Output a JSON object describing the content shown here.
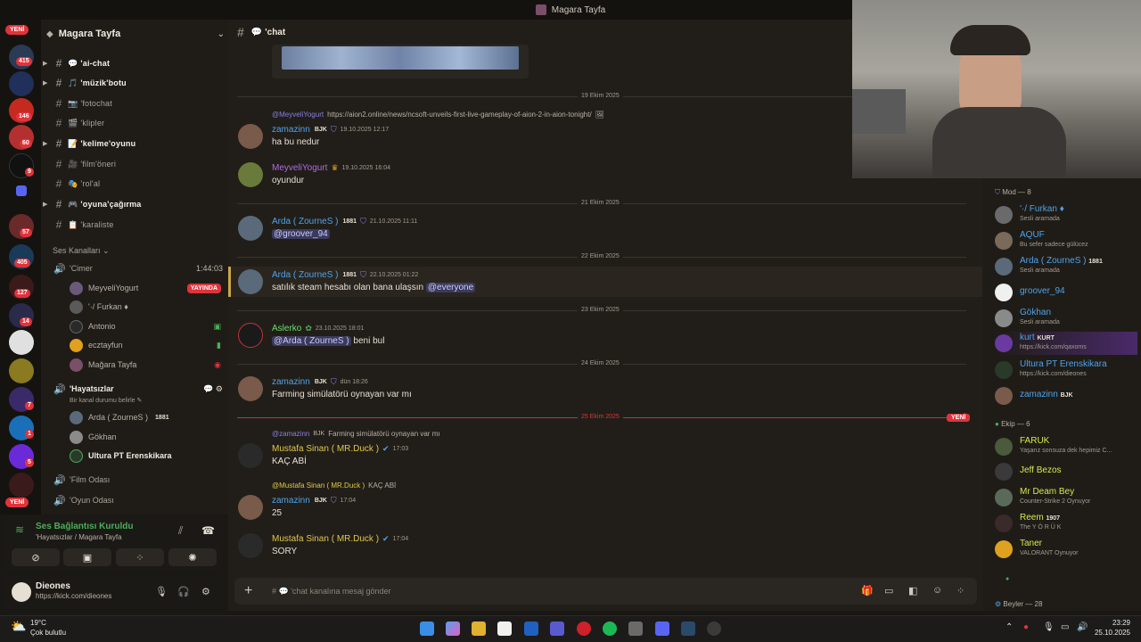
{
  "window": {
    "title": "Magara Tayfa"
  },
  "rail": {
    "yeni_top": "YENİ",
    "yeni_bottom": "YENİ",
    "badges": [
      "415",
      "146",
      "60",
      "9",
      "57",
      "405",
      "127",
      "14",
      "7",
      "1",
      "5"
    ]
  },
  "sidebar": {
    "guild_name": "Magara Tayfa",
    "channels": [
      {
        "emoji": "💬",
        "label": "'ai-chat",
        "unread": true
      },
      {
        "emoji": "🎵",
        "label": "'müzik'botu",
        "unread": true
      },
      {
        "emoji": "📷",
        "label": "'fotochat",
        "unread": false
      },
      {
        "emoji": "🎬",
        "label": "'klipler",
        "unread": false
      },
      {
        "emoji": "📝",
        "label": "'kelime'oyunu",
        "unread": true
      },
      {
        "emoji": "🎥",
        "label": "'film'öneri",
        "unread": false
      },
      {
        "emoji": "🎭",
        "label": "'rol'al",
        "unread": false
      },
      {
        "emoji": "🎮",
        "label": "'oyuna'çağırma",
        "unread": true
      },
      {
        "emoji": "📋",
        "label": "'karaliste",
        "unread": false
      }
    ],
    "voice_category": "Ses Kanalları",
    "voice_channels": {
      "cimer": {
        "label": "'Cimer",
        "time": "1:44:03"
      },
      "hayatsizlar": {
        "label": "'Hayatsızlar",
        "status": "Bir kanal durumu belirle"
      },
      "film": {
        "label": "'Film Odası"
      },
      "oyun": {
        "label": "'Oyun Odası"
      }
    },
    "cimer_users": [
      "MeyveliYogurt",
      "'·/ Furkan ♦",
      "Antonio",
      "ecztayfun",
      "Mağara Tayfa"
    ],
    "live_label": "YAYINDA",
    "hayat_users": [
      "Arda ( ZourneS )",
      "Gökhan",
      "Ultura PT Erenskikara"
    ],
    "hayat_tag": "1881"
  },
  "voice": {
    "connected": "Ses Bağlantısı Kuruldu",
    "location": "'Hayatsızlar / Magara Tayfa"
  },
  "user": {
    "name": "Dieones",
    "status": "https://kick.com/dieones"
  },
  "chat": {
    "channel_name": "'chat",
    "dates": [
      "19 Ekim 2025",
      "21 Ekim 2025",
      "22 Ekim 2025",
      "23 Ekim 2025",
      "24 Ekim 2025",
      "25 Ekim 2025"
    ],
    "yeni": "YENİ",
    "reply1": {
      "author": "@MeyveliYogurt",
      "text": "https://aion2.online/news/ncsoft-unveils-first-live-gameplay-of-aion-2-in-aion-tonight/"
    },
    "m1": {
      "author": "zamazinn",
      "tag": "BJK",
      "time": "19.10.2025 12:17",
      "text": "ha bu nedur"
    },
    "m2": {
      "author": "MeyveliYogurt",
      "time": "19.10.2025 16:04",
      "text": "oyundur"
    },
    "m3": {
      "author": "Arda ( ZourneS )",
      "tag": "1881",
      "time": "21.10.2025 11:11",
      "text": "@groover_94"
    },
    "m4": {
      "author": "Arda ( ZourneS )",
      "tag": "1881",
      "time": "22.10.2025 01:22",
      "text": "satılık steam hesabı olan bana ulaşsın",
      "mention": "@everyone"
    },
    "m5": {
      "author": "Aslerko",
      "time": "23.10.2025 18:01",
      "mention": "@Arda ( ZourneS )",
      "text": "beni bul"
    },
    "m6": {
      "author": "zamazinn",
      "tag": "BJK",
      "time": "dün 18:26",
      "text": "Farming simülatörü oynayan var mı"
    },
    "reply2": {
      "author": "@zamazinn",
      "tag": "BJK",
      "text": "Farming simülatörü oynayan var mı"
    },
    "m7": {
      "author": "Mustafa Sinan ( MR.Duck )",
      "time": "17:03",
      "text": "KAÇ ABİ"
    },
    "reply3": {
      "author": "@Mustafa Sinan ( MR.Duck )",
      "text": "KAÇ ABİ"
    },
    "m8": {
      "author": "zamazinn",
      "tag": "BJK",
      "time": "17:04",
      "text": "25"
    },
    "m9": {
      "author": "Mustafa Sinan ( MR.Duck )",
      "time": "17:04",
      "text": "SORY"
    },
    "input_placeholder": "'chat kanalına mesaj gönder"
  },
  "members": {
    "mod_header": "Mod — 8",
    "mods": [
      {
        "name": "'·/ Furkan ♦",
        "status": "Sesli aramada",
        "color": "#4fa3e8"
      },
      {
        "name": "AQUF",
        "status": "Bu sefer sadece gülücez",
        "color": "#4fa3e8"
      },
      {
        "name": "Arda ( ZourneS )",
        "tag": "1881",
        "status": "Sesli aramada",
        "color": "#4fa3e8"
      },
      {
        "name": "groover_94",
        "status": "",
        "color": "#4fa3e8"
      },
      {
        "name": "Gökhan",
        "status": "Sesli aramada",
        "color": "#4fa3e8"
      },
      {
        "name": "kurt",
        "tag": "KURT",
        "status": "https://kick.com/qaxoms",
        "color": "#4fa3e8"
      },
      {
        "name": "Ultura PT Erenskikara",
        "status": "https://kick.com/dieones",
        "color": "#4fa3e8"
      },
      {
        "name": "zamazinn",
        "tag": "BJK",
        "status": "",
        "color": "#4fa3e8"
      }
    ],
    "ekip_header": "Ekip — 6",
    "ekip": [
      {
        "name": "FARUK",
        "status": "Yaşarız sonsuza dek hepimiz C...",
        "color": "#d8e84a"
      },
      {
        "name": "Jeff Bezos",
        "status": "",
        "color": "#d8e84a"
      },
      {
        "name": "Mr Deam Bey",
        "status": "Counter-Strike 2 Oynuyor",
        "color": "#d8e84a"
      },
      {
        "name": "Reem",
        "tag": "1907",
        "status": "The Y Ö R Ü K",
        "color": "#d8e84a"
      },
      {
        "name": "Taner",
        "status": "VALORANT Oynuyor",
        "color": "#d8e84a"
      }
    ],
    "beyler_header": "Beyler — 28"
  },
  "taskbar": {
    "temp": "19°C",
    "weather": "Çok bulutlu",
    "time": "23:29",
    "date": "25.10.2025"
  }
}
